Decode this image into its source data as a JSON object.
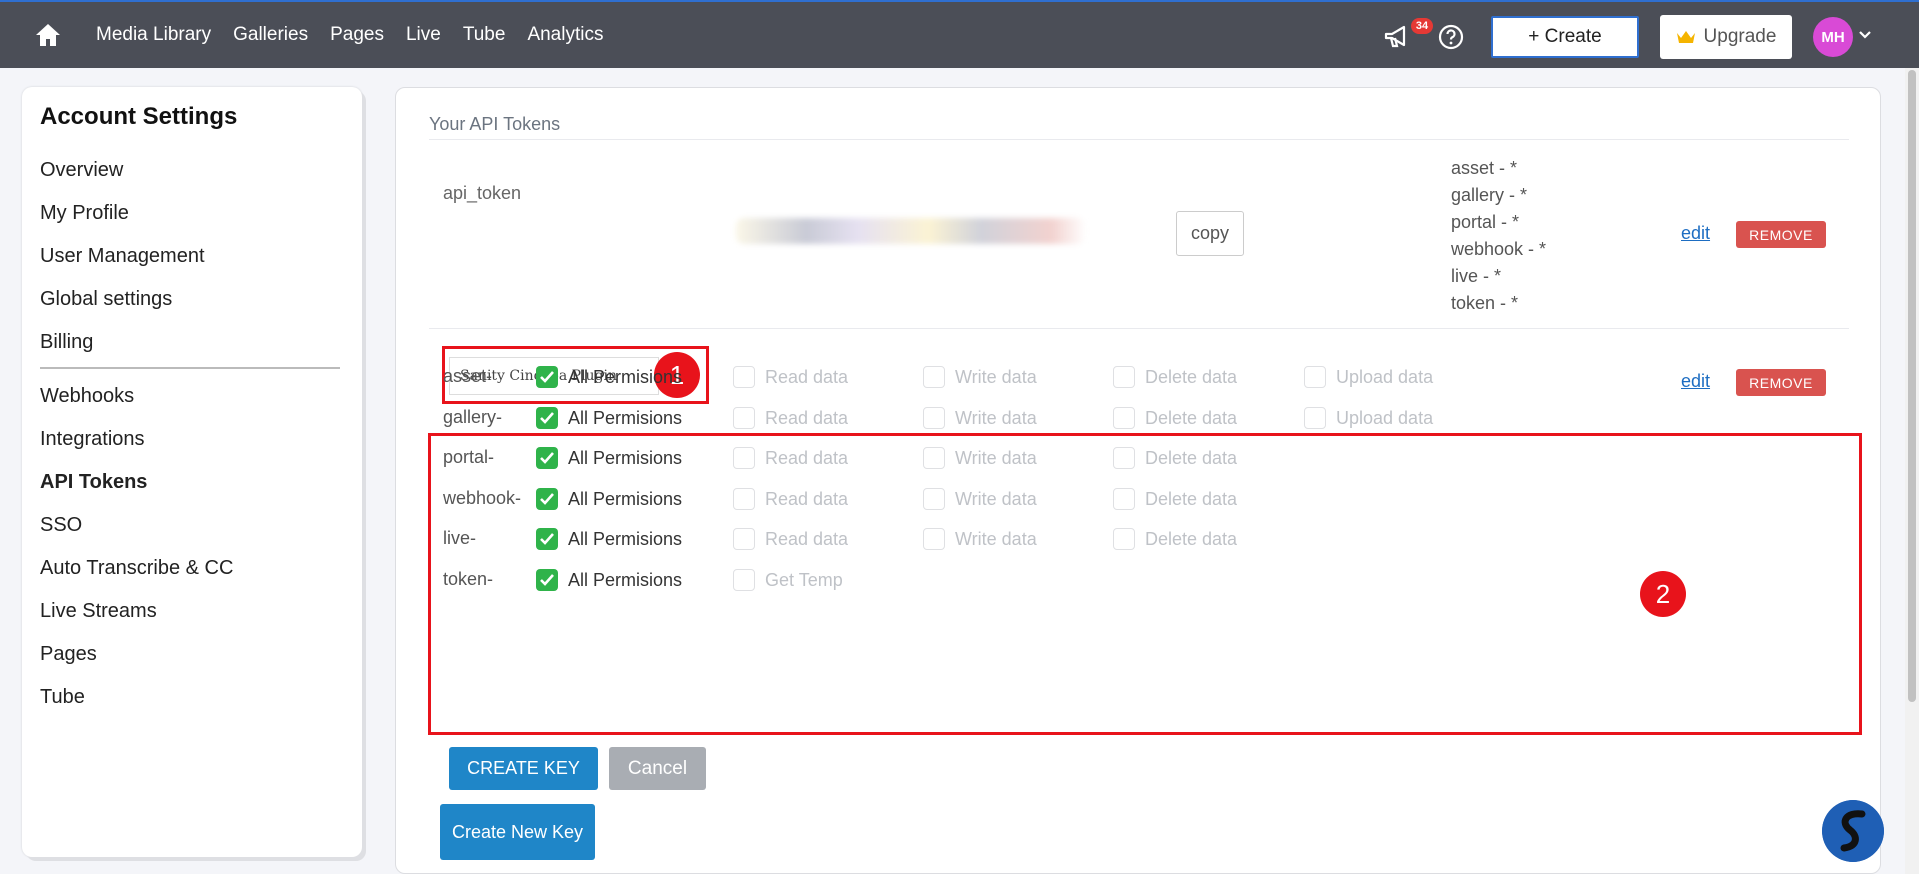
{
  "topbar": {
    "nav": [
      "Media Library",
      "Galleries",
      "Pages",
      "Live",
      "Tube",
      "Analytics"
    ],
    "notification_count": "34",
    "create_label": "+ Create",
    "upgrade_label": "Upgrade",
    "avatar_initials": "MH"
  },
  "sidebar": {
    "title": "Account Settings",
    "items": [
      "Overview",
      "My Profile",
      "User Management",
      "Global settings",
      "Billing"
    ],
    "items2": [
      "Webhooks",
      "Integrations",
      "API Tokens",
      "SSO",
      "Auto Transcribe & CC",
      "Live Streams",
      "Pages",
      "Tube"
    ],
    "active": "API Tokens"
  },
  "main": {
    "section_title": "Your API Tokens",
    "token": {
      "name": "api_token",
      "copy_label": "copy",
      "scopes": [
        "asset - *",
        "gallery - *",
        "portal - *",
        "webhook - *",
        "live - *",
        "token - *"
      ],
      "edit_label": "edit",
      "remove_label": "REMOVE"
    },
    "new_token": {
      "name_value": "Sanity Cincopa Plugin",
      "edit_label": "edit",
      "remove_label": "REMOVE"
    },
    "annotations": [
      "1",
      "2"
    ],
    "permissions": [
      {
        "label": "asset-",
        "all": "All Permisions",
        "opts": [
          "Read data",
          "Write data",
          "Delete data",
          "Upload data"
        ]
      },
      {
        "label": "gallery-",
        "all": "All Permisions",
        "opts": [
          "Read data",
          "Write data",
          "Delete data",
          "Upload data"
        ]
      },
      {
        "label": "portal-",
        "all": "All Permisions",
        "opts": [
          "Read data",
          "Write data",
          "Delete data"
        ]
      },
      {
        "label": "webhook-",
        "all": "All Permisions",
        "opts": [
          "Read data",
          "Write data",
          "Delete data"
        ]
      },
      {
        "label": "live-",
        "all": "All Permisions",
        "opts": [
          "Read data",
          "Write data",
          "Delete data"
        ]
      },
      {
        "label": "token-",
        "all": "All Permisions",
        "opts": [
          "Get Temp"
        ]
      }
    ],
    "create_key_label": "CREATE KEY",
    "cancel_label": "Cancel",
    "create_new_key_label": "Create New Key"
  },
  "colors": {
    "topbar": "#4b4e57",
    "primary": "#1f86c8",
    "danger": "#d9534f",
    "checked": "#2fb34a",
    "annotation": "#e8131b"
  }
}
